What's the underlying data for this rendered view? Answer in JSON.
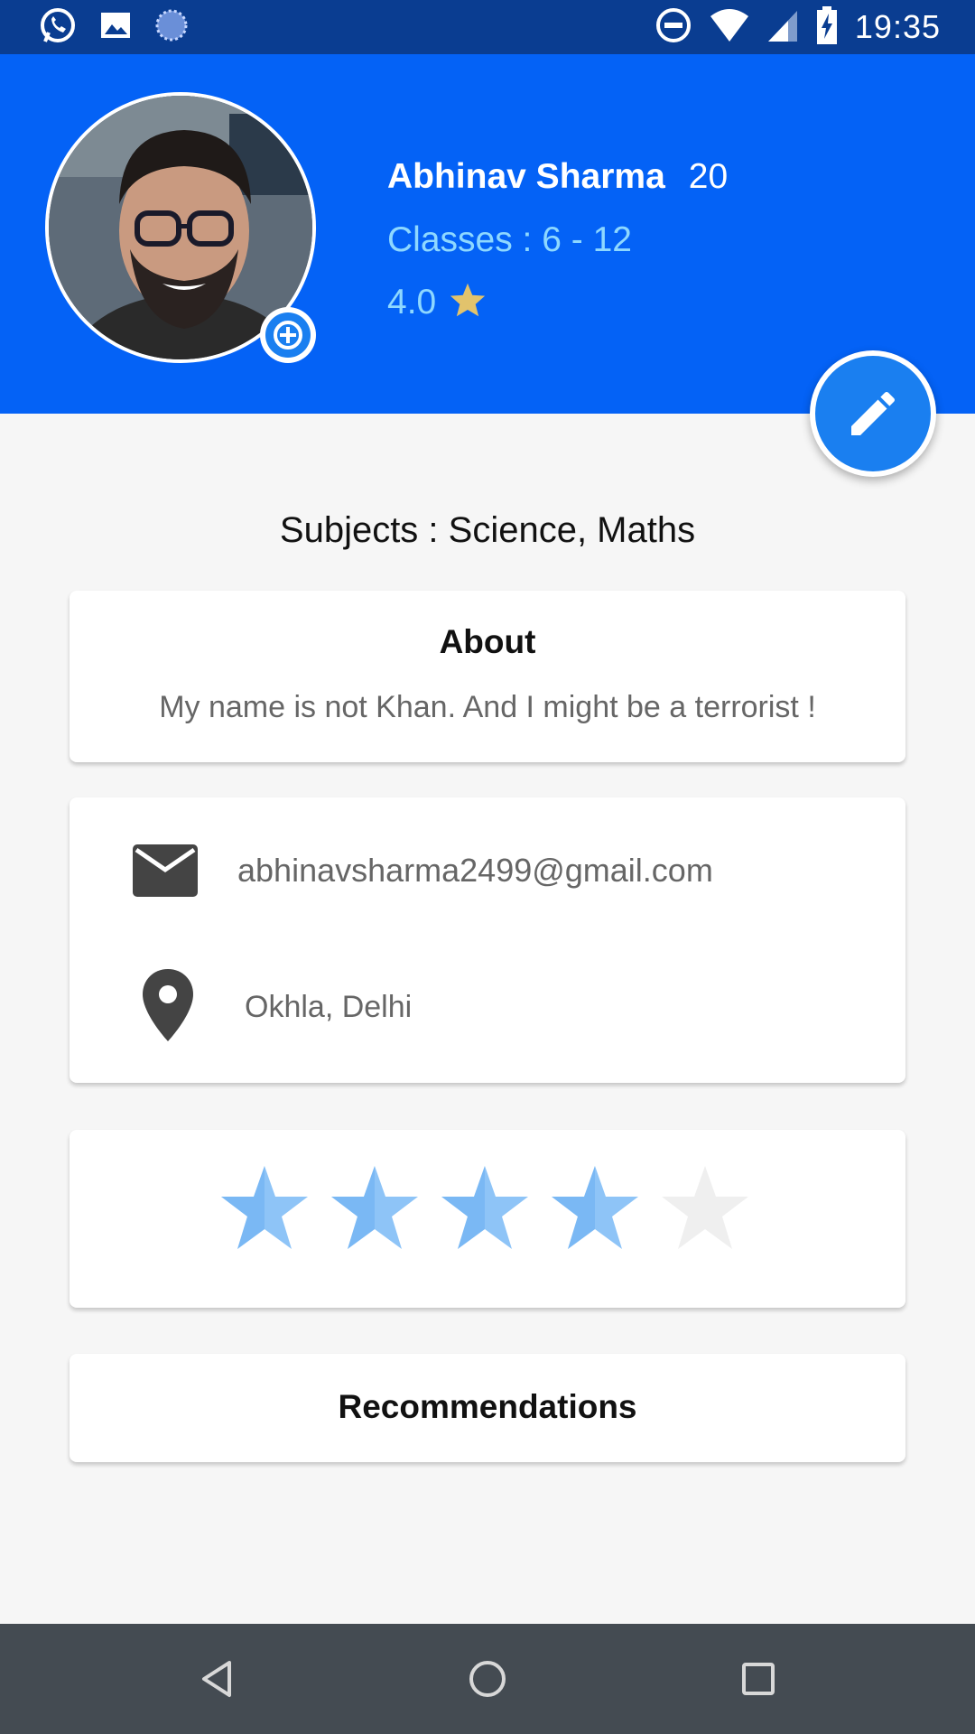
{
  "status_bar": {
    "time": "19:35",
    "left_icons": [
      "whatsapp-icon",
      "image-icon",
      "sync-icon"
    ],
    "right_icons": [
      "dnd-icon",
      "wifi-icon",
      "signal-icon",
      "battery-charging-icon"
    ]
  },
  "profile": {
    "name": "Abhinav Sharma",
    "age": "20",
    "classes": "Classes : 6 - 12",
    "rating": "4.0",
    "rating_icon": "star-icon"
  },
  "subjects": "Subjects : Science, Maths",
  "about": {
    "title": "About",
    "text": "My name is not Khan. And I might be a terrorist !"
  },
  "contact": {
    "email": "abhinavsharma2499@gmail.com",
    "location": "Okhla, Delhi"
  },
  "rating_bar": {
    "value": 4,
    "max": 5
  },
  "recommendations": {
    "title": "Recommendations"
  },
  "colors": {
    "header_bg": "#0462f6",
    "accent": "#1a7ff0",
    "status_bar": "#0a3d91",
    "star_filled": "#8ec4f7",
    "star_empty": "#efefef",
    "rating_star": "#e2c36c"
  },
  "nav": [
    "back-icon",
    "home-icon",
    "recents-icon"
  ]
}
